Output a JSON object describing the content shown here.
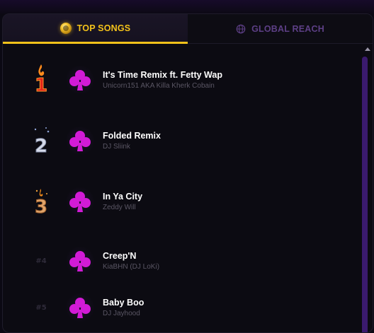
{
  "tabs": {
    "top_songs": "TOP SONGS",
    "global_reach": "GLOBAL REACH"
  },
  "songs": [
    {
      "rank": "1",
      "title": "It's Time Remix ft. Fetty Wap",
      "artist": "Unicorn151 AKA Killa Kherk Cobain"
    },
    {
      "rank": "2",
      "title": "Folded Remix",
      "artist": "DJ Sliink"
    },
    {
      "rank": "3",
      "title": "In Ya City",
      "artist": "Zeddy Will"
    },
    {
      "rank": "#4",
      "title": "Creep'N",
      "artist": "KiaBHN (DJ LoKi)"
    },
    {
      "rank": "#5",
      "title": "Baby Boo",
      "artist": "DJ Jayhood"
    }
  ],
  "colors": {
    "accent": "#f3c21a",
    "inactive_tab": "#5d3f86",
    "club_icon": "#d21bd6",
    "background": "#0c0b12"
  },
  "icons": {
    "top_songs": "gold-coin-icon",
    "global_reach": "globe-icon",
    "artwork": "club-icon",
    "rank_1": "fire-medal-1",
    "rank_2": "silver-medal-2",
    "rank_3": "bronze-medal-3"
  }
}
